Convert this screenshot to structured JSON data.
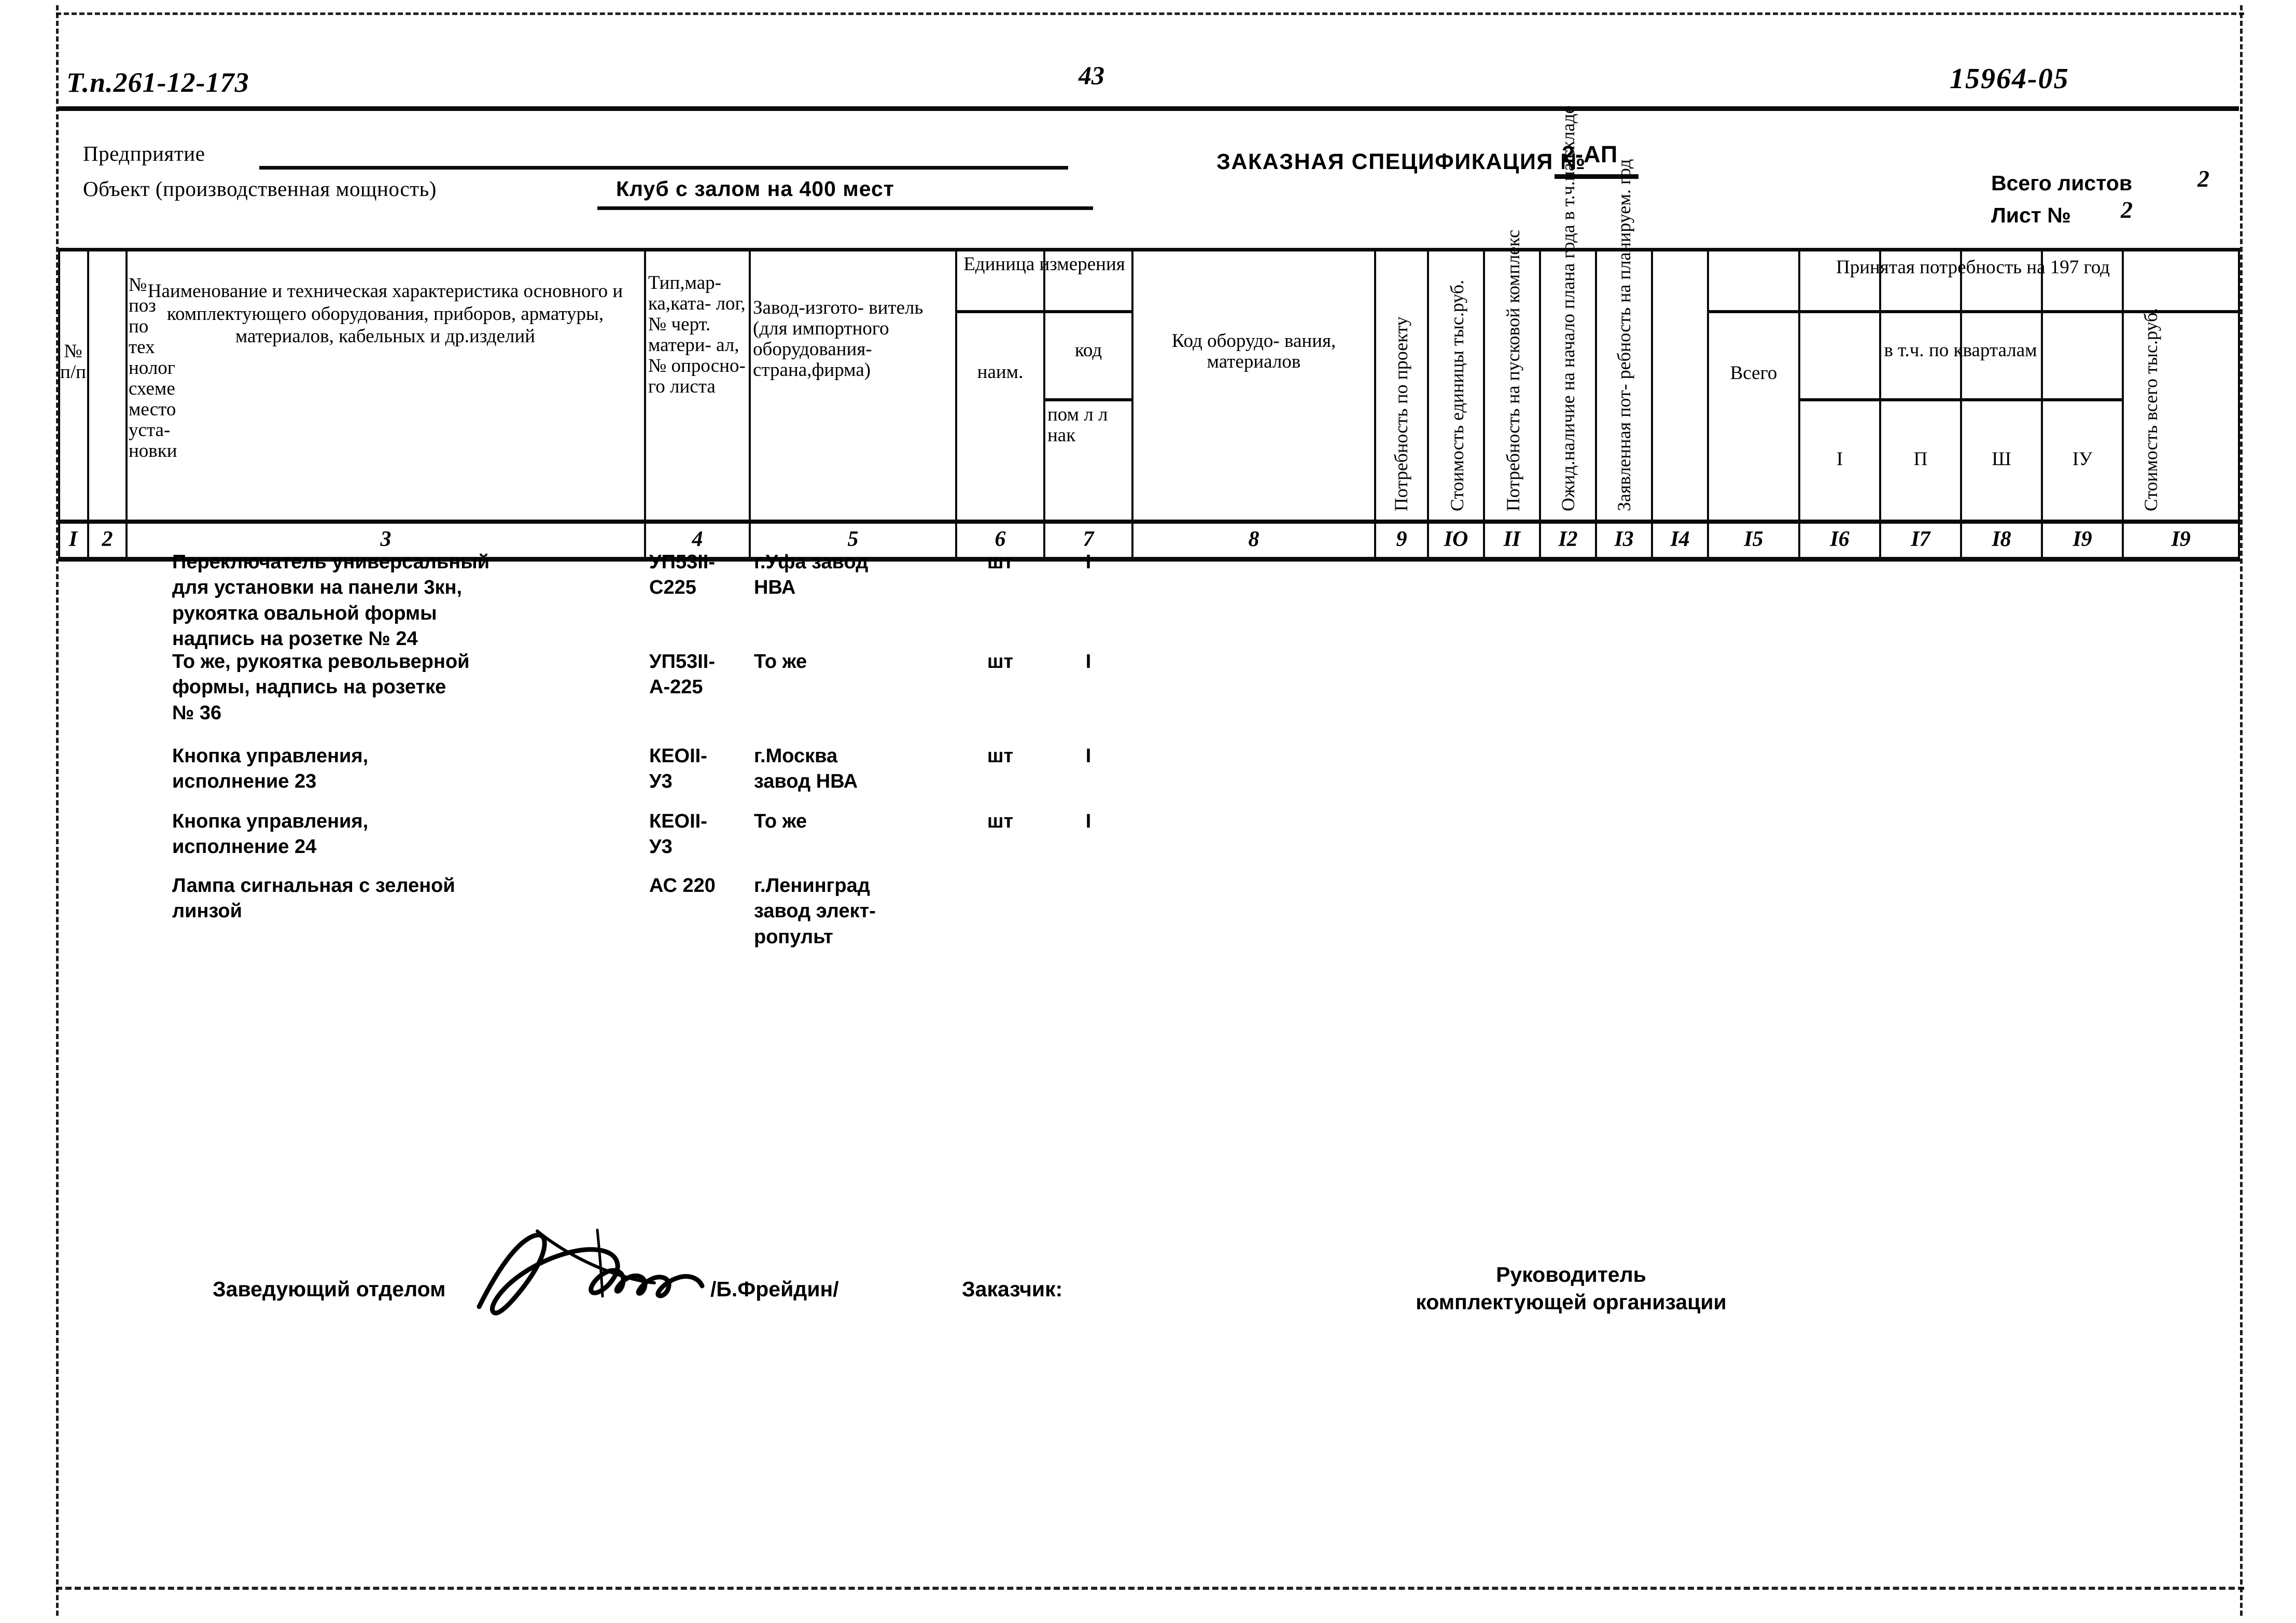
{
  "page": {
    "project_code": "Т.п.261-12-173",
    "page_number": "43",
    "doc_number": "15964-05"
  },
  "header": {
    "enterprise_label": "Предприятие",
    "enterprise_value": "",
    "object_label": "Объект (производственная мощность)",
    "object_value": "Клуб с залом на 400 мест",
    "spec_title": "ЗАКАЗНАЯ СПЕЦИФИКАЦИЯ №",
    "spec_number": "2-АП",
    "total_sheets_label": "Всего листов",
    "total_sheets_value": "2",
    "sheet_label": "Лист №",
    "sheet_value": "2"
  },
  "table": {
    "headers": {
      "c1": "№\nп/п",
      "c2": "№ поз\nпо тех\nнолог\nсхеме\nместо\nуста-\nновки",
      "c3": "Наименование и техническая\nхарактеристика основного и\nкомплектующего оборудования,\nприборов, арматуры, материалов,\nкабельных и др.изделий",
      "c4": "Тип,мар-\nка,ката-\nлог, №\nчерт.\nматери-\nал, №\nопросно-\nго листа",
      "c5": "Завод-изгото-\nвитель (для\nимпортного\nоборудования-\nстрана,фирма)",
      "unit_group": "Единица\nизмерения",
      "c6": "наим.",
      "c7a": "код",
      "c7b": "пом л\nл нак",
      "c8": "Код оборудо-\nвания,\nматериалов",
      "c9": "Потребность\nпо проекту",
      "c10": "Стоимость\nединицы\nтыс.руб.",
      "c11": "Потребность\nна пусковой\nкомплекс",
      "c12": "Ожид.наличие на\nначало плана года\nв т.ч.на складе",
      "c13": "Заявленная пот-\nребность на\nпланируем. год",
      "need_group": "Принятая потребность\nна 197        год",
      "c14": "Всего",
      "quarters_group": "в т.ч. по кварталам",
      "c15": "I",
      "c16": "П",
      "c17": "Ш",
      "c18": "IУ",
      "c19": "Стоимость\nвсего\nтыс.руб."
    },
    "column_numbers": [
      "I",
      "2",
      "3",
      "4",
      "5",
      "6",
      "7",
      "8",
      "9",
      "IO",
      "II",
      "I2",
      "I3",
      "I4",
      "I5",
      "I6",
      "I7",
      "I8",
      "I9"
    ],
    "rows": [
      {
        "num": "",
        "pos": "",
        "name": "Переключатель универсальный\nдля установки на панели 3кн,\nрукоятка овальной формы\nнадпись на розетке № 24",
        "type": "УП53II-\nС225",
        "factory": "г.Уфа завод\nНВА",
        "unit": "шт",
        "code_unit": "I",
        "equip_code": "",
        "need_project": "",
        "unit_cost": "",
        "need_startup": "",
        "expected_stock": "",
        "declared_need": "",
        "total": "",
        "q1": "",
        "q2": "",
        "q3": "",
        "q4": "",
        "total_cost": ""
      },
      {
        "num": "",
        "pos": "",
        "name": "То же, рукоятка револьверной\nформы, надпись на розетке\n№ 36",
        "type": "УП53II-\nА-225",
        "factory": "То же",
        "unit": "шт",
        "code_unit": "I",
        "equip_code": "",
        "need_project": "",
        "unit_cost": "",
        "need_startup": "",
        "expected_stock": "",
        "declared_need": "",
        "total": "",
        "q1": "",
        "q2": "",
        "q3": "",
        "q4": "",
        "total_cost": ""
      },
      {
        "num": "",
        "pos": "",
        "name": "Кнопка управления,\nисполнение 23",
        "type": "КЕОII-\nУ3",
        "factory": "г.Москва\nзавод НВА",
        "unit": "шт",
        "code_unit": "I",
        "equip_code": "",
        "need_project": "",
        "unit_cost": "",
        "need_startup": "",
        "expected_stock": "",
        "declared_need": "",
        "total": "",
        "q1": "",
        "q2": "",
        "q3": "",
        "q4": "",
        "total_cost": ""
      },
      {
        "num": "",
        "pos": "",
        "name": "Кнопка управления,\nисполнение 24",
        "type": "КЕОII-\nУ3",
        "factory": "То же",
        "unit": "шт",
        "code_unit": "I",
        "equip_code": "",
        "need_project": "",
        "unit_cost": "",
        "need_startup": "",
        "expected_stock": "",
        "declared_need": "",
        "total": "",
        "q1": "",
        "q2": "",
        "q3": "",
        "q4": "",
        "total_cost": ""
      },
      {
        "num": "",
        "pos": "",
        "name": "Лампа сигнальная с зеленой\nлинзой",
        "type": "АС 220",
        "factory": "г.Ленинград\nзавод элект-\nропульт",
        "unit": "",
        "code_unit": "",
        "equip_code": "",
        "need_project": "",
        "unit_cost": "",
        "need_startup": "",
        "expected_stock": "",
        "declared_need": "",
        "total": "",
        "q1": "",
        "q2": "",
        "q3": "",
        "q4": "",
        "total_cost": ""
      }
    ]
  },
  "footer": {
    "dept_head_label": "Заведующий отделом",
    "dept_head_name": "/Б.Фрейдин/",
    "customer_label": "Заказчик:",
    "supplier_head_label": "Руководитель\nкомплектующей организации"
  }
}
